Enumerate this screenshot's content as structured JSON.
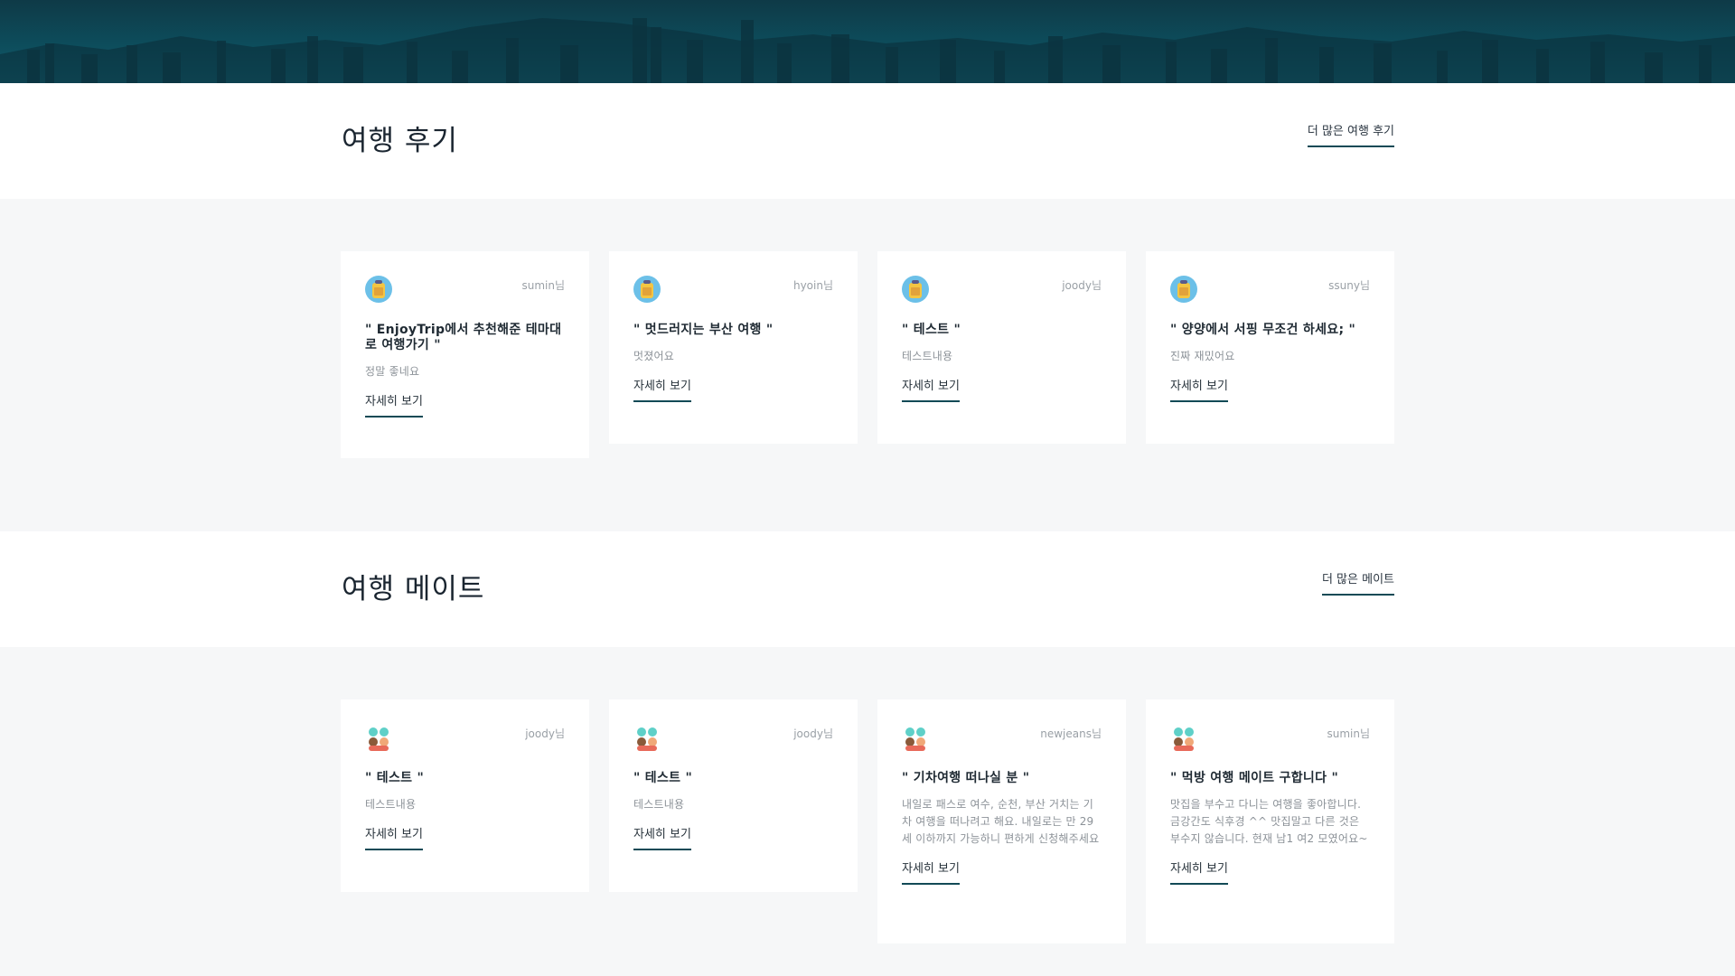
{
  "reviews": {
    "title": "여행 후기",
    "more_label": "더 많은 여행 후기",
    "cards": [
      {
        "author": "sumin님",
        "title": "\" EnjoyTrip에서 추천해준 테마대로 여행가기 \"",
        "body": "정말 좋네요",
        "link": "자세히 보기"
      },
      {
        "author": "hyoin님",
        "title": "\" 멋드러지는 부산 여행 \"",
        "body": "멋졌어요",
        "link": "자세히 보기"
      },
      {
        "author": "joody님",
        "title": "\" 테스트 \"",
        "body": "테스트내용",
        "link": "자세히 보기"
      },
      {
        "author": "ssuny님",
        "title": "\" 양양에서 서핑 무조건 하세요; \"",
        "body": "진짜 재밌어요",
        "link": "자세히 보기"
      }
    ]
  },
  "mates": {
    "title": "여행 메이트",
    "more_label": "더 많은 메이트",
    "cards": [
      {
        "author": "joody님",
        "title": "\" 테스트 \"",
        "body": "테스트내용",
        "link": "자세히 보기"
      },
      {
        "author": "joody님",
        "title": "\" 테스트 \"",
        "body": "테스트내용",
        "link": "자세히 보기"
      },
      {
        "author": "newjeans님",
        "title": "\" 기차여행 떠나실 분 \"",
        "body": "내일로 패스로 여수, 순천, 부산 거치는 기차 여행을 떠나려고 해요. 내일로는 만 29세 이하까지 가능하니 편하게 신청해주세요",
        "link": "자세히 보기"
      },
      {
        "author": "sumin님",
        "title": "\" 먹방 여행 메이트 구합니다 \"",
        "body": "맛집을 부수고 다니는 여행을 좋아합니다. 금강간도 식후경 ^^ 맛집말고 다른 것은 부수지 않습니다. 현재 남1 여2 모였어요~",
        "link": "자세히 보기"
      }
    ]
  },
  "icons": {
    "review_avatar": "traveler-bag-icon",
    "mate_avatar": "two-people-icon"
  },
  "colors": {
    "accent": "#124a56",
    "band": "#f6f7f8",
    "hero": "#0d4d5c"
  }
}
